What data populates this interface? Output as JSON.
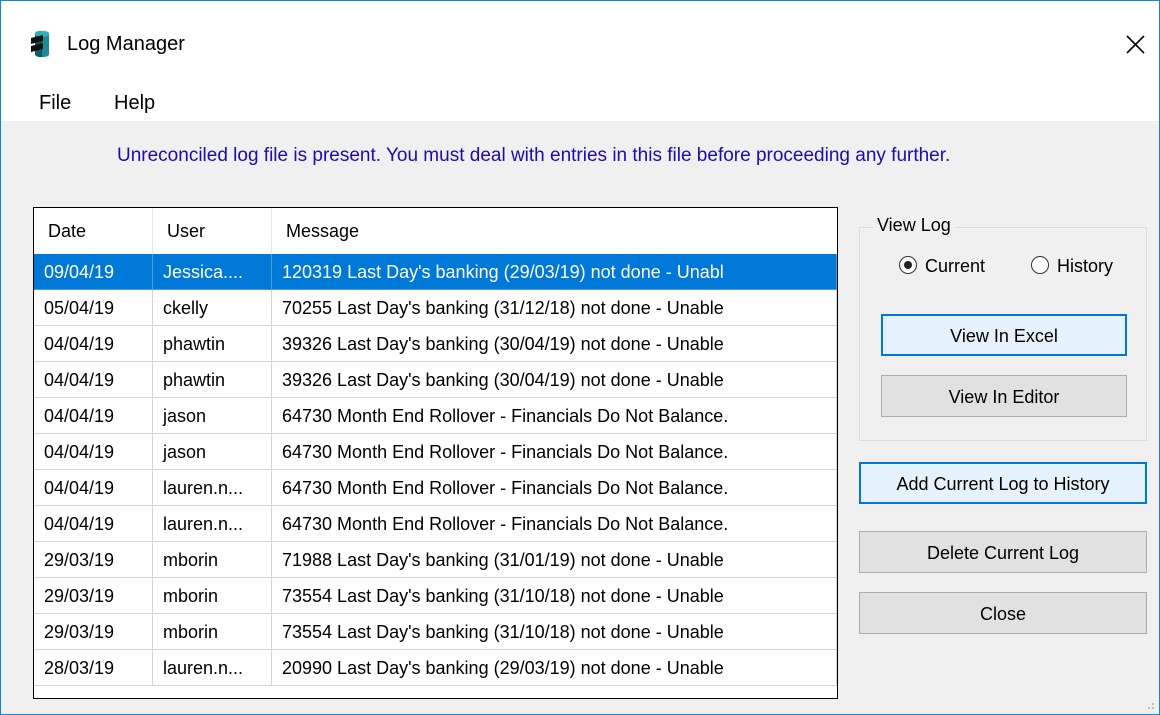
{
  "window": {
    "title": "Log Manager"
  },
  "menu": {
    "items": [
      "File",
      "Help"
    ]
  },
  "warning": {
    "text": "Unreconciled log file is present. You must deal with entries in this file before proceeding any further."
  },
  "log_table": {
    "columns": [
      "Date",
      "User",
      "Message"
    ],
    "rows": [
      [
        "09/04/19",
        "Jessica....",
        "120319   Last Day's banking (29/03/19) not done - Unabl"
      ],
      [
        "05/04/19",
        "ckelly",
        "70255    Last Day's banking (31/12/18) not done - Unable"
      ],
      [
        "04/04/19",
        "phawtin",
        "39326    Last Day's banking (30/04/19) not done - Unable"
      ],
      [
        "04/04/19",
        "phawtin",
        "39326    Last Day's banking (30/04/19) not done - Unable"
      ],
      [
        "04/04/19",
        "jason",
        "64730   Month End Rollover - Financials Do Not Balance."
      ],
      [
        "04/04/19",
        "jason",
        "64730   Month End Rollover - Financials Do Not Balance."
      ],
      [
        "04/04/19",
        "lauren.n...",
        "64730   Month End Rollover - Financials Do Not Balance."
      ],
      [
        "04/04/19",
        "lauren.n...",
        "64730   Month End Rollover - Financials Do Not Balance."
      ],
      [
        "29/03/19",
        "mborin",
        "71988    Last Day's banking (31/01/19) not done - Unable"
      ],
      [
        "29/03/19",
        "mborin",
        "73554    Last Day's banking (31/10/18) not done - Unable"
      ],
      [
        "29/03/19",
        "mborin",
        "73554    Last Day's banking (31/10/18) not done - Unable"
      ],
      [
        "28/03/19",
        "lauren.n...",
        "20990    Last Day's banking (29/03/19) not done - Unable"
      ]
    ],
    "selected_row": 0
  },
  "view_log": {
    "group_label": "View Log",
    "radio_current": "Current",
    "radio_history": "History",
    "selected": "Current",
    "view_excel_label": "View In Excel",
    "view_editor_label": "View In Editor"
  },
  "actions": {
    "add_history_label": "Add Current Log to History",
    "delete_label": "Delete Current Log",
    "close_label": "Close"
  },
  "colors": {
    "accent": "#0078d7",
    "warning_text": "#1a0dab",
    "window_bg": "#f0f0f0"
  },
  "icons": {
    "app": "database-icon",
    "close": "close-icon"
  }
}
